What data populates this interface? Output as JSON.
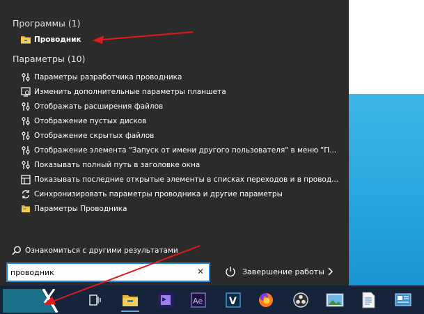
{
  "start_menu": {
    "apps_header": "Программы (1)",
    "apps": [
      {
        "label": "Проводник",
        "icon": "folder-icon"
      }
    ],
    "settings_header": "Параметры (10)",
    "settings": [
      {
        "label": "Параметры разработчика проводника",
        "icon": "settings-slider-icon"
      },
      {
        "label": "Изменить дополнительные параметры планшета",
        "icon": "tablet-mode-icon"
      },
      {
        "label": "Отображать расширения файлов",
        "icon": "settings-slider-icon"
      },
      {
        "label": "Отображение пустых дисков",
        "icon": "settings-slider-icon"
      },
      {
        "label": "Отображение скрытых файлов",
        "icon": "settings-slider-icon"
      },
      {
        "label": "Отображение элемента \"Запуск от имени другого пользователя\" в меню \"П...",
        "icon": "settings-slider-icon"
      },
      {
        "label": "Показывать полный путь в заголовке окна",
        "icon": "settings-slider-icon"
      },
      {
        "label": "Показывать последние открытые элементы в списках переходов и в провод...",
        "icon": "recent-items-icon"
      },
      {
        "label": "Синхронизировать параметры проводника и другие параметры",
        "icon": "sync-icon"
      },
      {
        "label": "Параметры Проводника",
        "icon": "folder-options-icon"
      }
    ],
    "more_results": "Ознакомиться с другими результатами",
    "search": {
      "value": "проводник"
    },
    "shutdown_label": "Завершение работы"
  },
  "taskbar": {
    "apps": [
      "task-view-icon",
      "file-explorer-icon",
      "premiere-icon",
      "after-effects-icon",
      "vegas-icon",
      "firefox-icon",
      "obs-icon",
      "photo-viewer-icon",
      "document-icon",
      "control-panel-icon"
    ]
  },
  "colors": {
    "panel_bg": "#2b2b2b",
    "taskbar_bg": "#15243a",
    "accent": "#1e88d8",
    "annotation_arrow": "#e3191c"
  }
}
